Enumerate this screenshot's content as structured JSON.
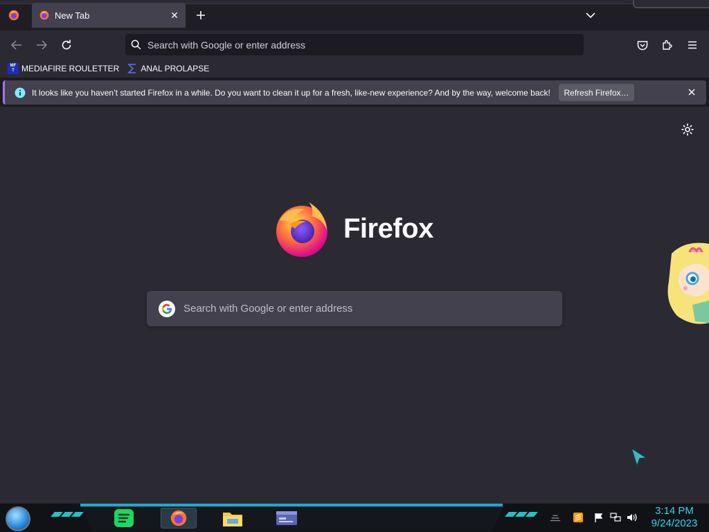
{
  "browser": {
    "tab": {
      "title": "New Tab"
    },
    "urlbar": {
      "placeholder": "Search with Google or enter address"
    },
    "bookmarks": [
      {
        "label": "MEDIAFIRE ROULETTER",
        "icon": "mft-icon",
        "icon_text": "MF T"
      },
      {
        "label": "ANAL PROLAPSE",
        "icon": "sigma-icon"
      }
    ],
    "notification": {
      "message": "It looks like you haven’t started Firefox in a while. Do you want to clean it up for a fresh, like-new experience? And by the way, welcome back!",
      "button": "Refresh Firefox…"
    }
  },
  "newtab": {
    "brand": "Firefox",
    "search_placeholder": "Search with Google or enter address"
  },
  "taskbar": {
    "time": "3:14 PM",
    "date": "9/24/2023",
    "apps": [
      "spotify-icon",
      "firefox-icon",
      "file-explorer-icon",
      "window-icon"
    ]
  },
  "colors": {
    "toolbar": "#2b2a33",
    "tab_active": "#42414d",
    "content_bg": "#2b2a33",
    "accent": "#ac70ff",
    "clock": "#2fd8f0",
    "taskbar_accent": "#1fa8d1"
  }
}
